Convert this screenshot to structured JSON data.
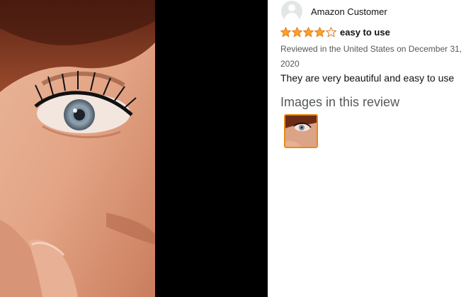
{
  "review": {
    "reviewer_name": "Amazon Customer",
    "rating": 4,
    "rating_max": 5,
    "title": "easy to use",
    "meta": "Reviewed in the United States on December 31, 2020",
    "body": "They are very beautiful and easy to use",
    "images_heading": "Images in this review"
  },
  "colors": {
    "star_fill": "#ffa41c",
    "star_stroke": "#de7921",
    "thumb_border": "#e88a14"
  },
  "icons": {
    "avatar": "person-avatar-icon",
    "star_full": "star-filled-icon",
    "star_empty": "star-empty-icon"
  }
}
